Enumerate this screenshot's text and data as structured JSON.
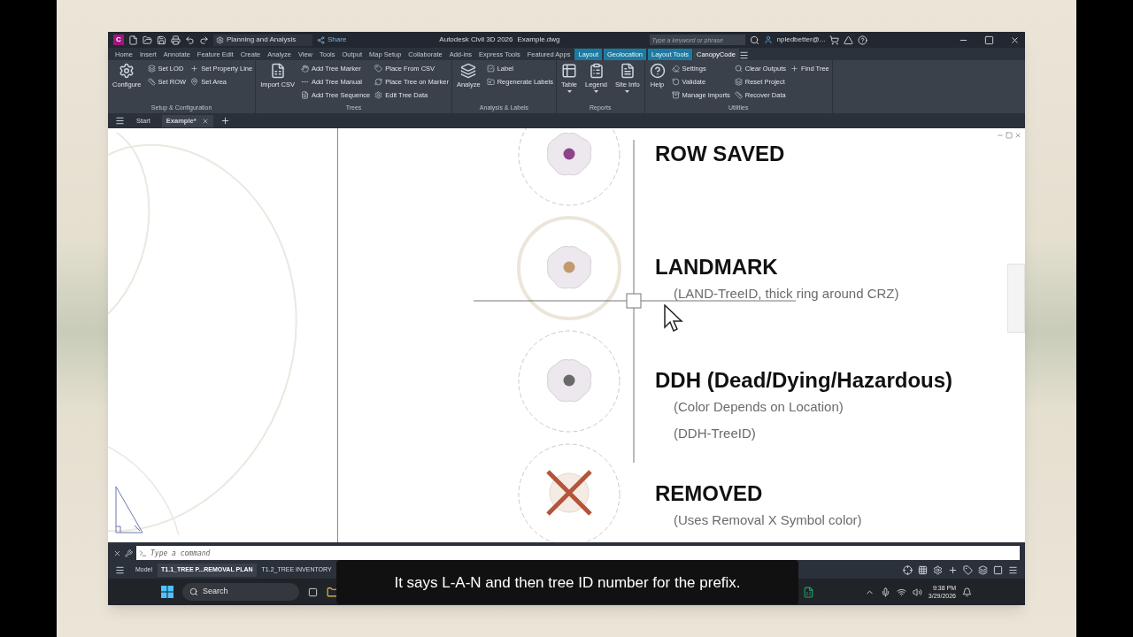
{
  "window": {
    "app_badge": "C",
    "title": "Autodesk Civil 3D 2026",
    "file": "Example.dwg"
  },
  "quick_access": {
    "workspace": "Planning and Analysis",
    "share": "Share"
  },
  "search": {
    "placeholder": "Type a keyword or phrase"
  },
  "user": "npledbetter@...",
  "ribbon_tabs": [
    {
      "label": "Home",
      "selected": false,
      "contextual": false
    },
    {
      "label": "Insert",
      "selected": false,
      "contextual": false
    },
    {
      "label": "Annotate",
      "selected": false,
      "contextual": false
    },
    {
      "label": "Feature Edit",
      "selected": false,
      "contextual": false
    },
    {
      "label": "Create",
      "selected": false,
      "contextual": false
    },
    {
      "label": "Analyze",
      "selected": false,
      "contextual": false
    },
    {
      "label": "View",
      "selected": false,
      "contextual": false
    },
    {
      "label": "Tools",
      "selected": false,
      "contextual": false
    },
    {
      "label": "Output",
      "selected": false,
      "contextual": false
    },
    {
      "label": "Map Setup",
      "selected": false,
      "contextual": false
    },
    {
      "label": "Collaborate",
      "selected": false,
      "contextual": false
    },
    {
      "label": "Add-ins",
      "selected": false,
      "contextual": false
    },
    {
      "label": "Express Tools",
      "selected": false,
      "contextual": false
    },
    {
      "label": "Featured Apps",
      "selected": false,
      "contextual": false
    },
    {
      "label": "Layout",
      "selected": false,
      "contextual": true
    },
    {
      "label": "Geolocation",
      "selected": false,
      "contextual": true
    },
    {
      "label": "Layout Tools",
      "selected": false,
      "contextual": true
    },
    {
      "label": "CanopyCode",
      "selected": true,
      "contextual": false
    }
  ],
  "ribbon_panels": [
    {
      "title": "Setup & Configuration",
      "large": [
        {
          "label": "Configure",
          "dropdown": false
        }
      ],
      "columns": [
        [
          "Set LOD",
          "Set ROW"
        ],
        [
          "Set Property Line",
          "Set Area"
        ]
      ]
    },
    {
      "title": "Trees",
      "large": [
        {
          "label": "Import CSV",
          "dropdown": false
        }
      ],
      "columns": [
        [
          "Add Tree Marker",
          "Add Tree Manual",
          "Add Tree Sequence"
        ],
        [
          "Place From CSV",
          "Place Tree on Marker",
          "Edit Tree Data"
        ]
      ]
    },
    {
      "title": "Analysis & Labels",
      "large": [
        {
          "label": "Analyze",
          "dropdown": false
        }
      ],
      "columns": [
        [
          "Label",
          "Regenerate Labels"
        ]
      ]
    },
    {
      "title": "Reports",
      "large": [
        {
          "label": "Table",
          "dropdown": true
        },
        {
          "label": "Legend",
          "dropdown": true
        },
        {
          "label": "Site Info",
          "dropdown": true
        }
      ]
    },
    {
      "title": "Utilities",
      "large": [
        {
          "label": "Help",
          "dropdown": false
        }
      ],
      "columns": [
        [
          "Settings",
          "Validate",
          "Manage Imports"
        ],
        [
          "Clear Outputs",
          "Reset Project",
          "Recover Data"
        ],
        [
          "Find Tree"
        ]
      ]
    }
  ],
  "file_tabs": [
    {
      "label": "Start",
      "selected": false,
      "closable": false
    },
    {
      "label": "Example*",
      "selected": true,
      "closable": true
    }
  ],
  "legend": [
    {
      "kind": "dot",
      "thick_ring": false,
      "color": "#8d4489",
      "title": "ROW SAVED"
    },
    {
      "kind": "dot",
      "thick_ring": true,
      "color": "#c39a6e",
      "title": "LANDMARK",
      "notes": [
        "(LAND-TreeID, thick ring around CRZ)"
      ]
    },
    {
      "kind": "dot",
      "thick_ring": false,
      "color": "#6a6a6a",
      "title": "DDH (Dead/Dying/Hazardous)",
      "notes": [
        "(Color Depends on Location)",
        "(DDH-TreeID)"
      ]
    },
    {
      "kind": "x",
      "thick_ring": false,
      "color": "#b4553b",
      "title": "REMOVED",
      "notes": [
        "(Uses Removal X Symbol color)"
      ]
    }
  ],
  "command_line": {
    "placeholder": "Type a command"
  },
  "layout_tabs": [
    {
      "label": "Model",
      "selected": false
    },
    {
      "label": "T1.1_TREE P...REMOVAL PLAN",
      "selected": true
    },
    {
      "label": "T1.2_TREE INVENTORY",
      "selected": false
    }
  ],
  "taskbar": {
    "search": "Search",
    "time": "9:38 PM",
    "date": "3/29/2026"
  },
  "caption": "It says L-A-N and then tree ID number for the prefix."
}
